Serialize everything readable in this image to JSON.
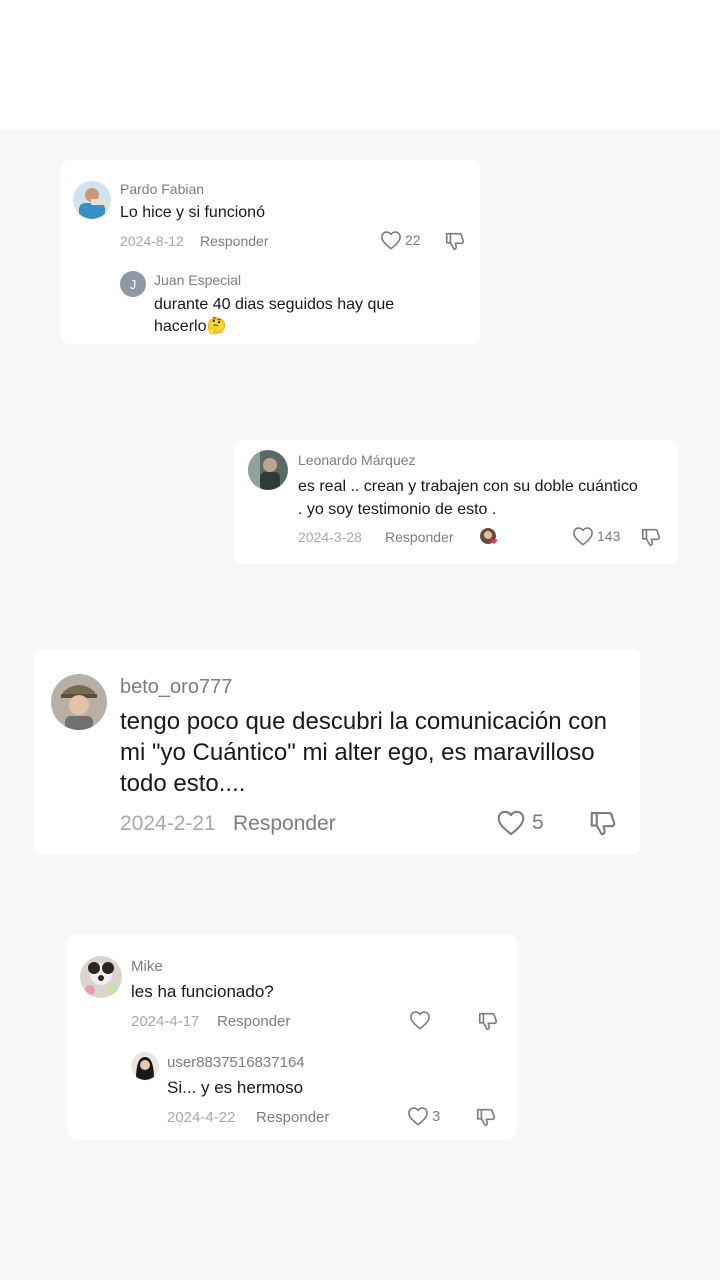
{
  "threads": [
    {
      "comment": {
        "username": "Pardo Fabian",
        "text": "Lo hice y si funcionó",
        "date": "2024-8-12",
        "reply_label": "Responder",
        "likes": "22"
      },
      "reply": {
        "avatar_letter": "J",
        "username": "Juan Especial",
        "text": "durante 40 dias seguidos hay que hacerlo🤔"
      }
    },
    {
      "comment": {
        "username": "Leonardo Márquez",
        "text": "es real .. crean y trabajen con su doble cuántico . yo soy testimonio de esto .",
        "date": "2024-3-28",
        "reply_label": "Responder",
        "likes": "143"
      }
    },
    {
      "comment": {
        "username": "beto_oro777",
        "text": "tengo poco que descubri la comunicación con mi \"yo Cuántico\" mi alter ego, es maravilloso todo esto....",
        "date": "2024-2-21",
        "reply_label": "Responder",
        "likes": "5"
      }
    },
    {
      "comment": {
        "username": "Mike",
        "text": "les ha funcionado?",
        "date": "2024-4-17",
        "reply_label": "Responder"
      },
      "reply": {
        "username": "user8837516837164",
        "text": "Si... y es hermoso",
        "date": "2024-4-22",
        "reply_label": "Responder",
        "likes": "3"
      }
    }
  ],
  "colors": {
    "background": "#f7f7f7",
    "card": "#ffffff",
    "username": "#7b7d85",
    "text": "#161823",
    "meta": "#a7a8ad"
  },
  "icons": [
    "heart-outline-icon",
    "thumbs-down-icon",
    "creator-liked-badge"
  ]
}
